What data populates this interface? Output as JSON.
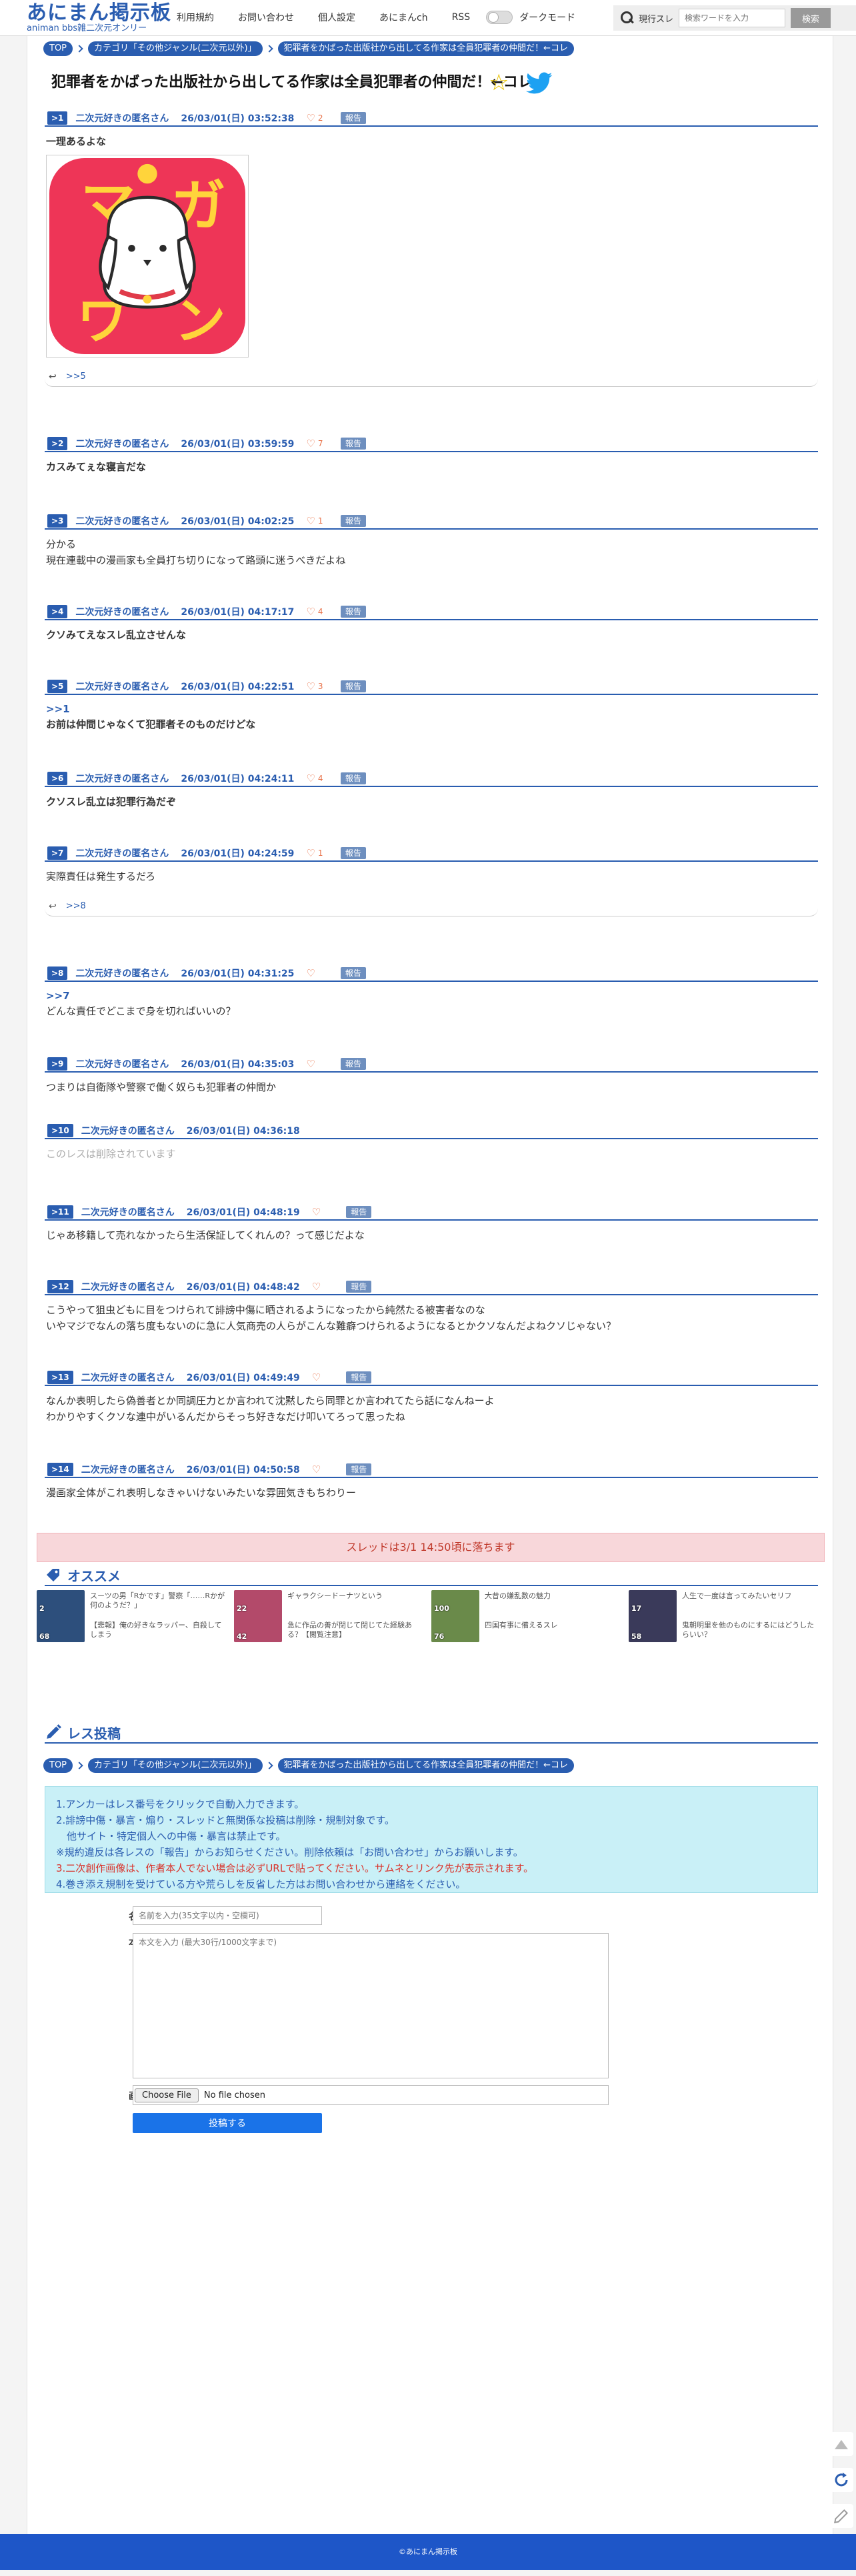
{
  "header": {
    "logo_main": "あにまん掲示板",
    "logo_sub": "animan bbs雑二次元オンリー",
    "nav": [
      "利用規約",
      "お問い合わせ",
      "個人設定",
      "あにまんch",
      "RSS"
    ],
    "dark_mode_label": "ダークモード",
    "search_scope": "現行スレ",
    "search_placeholder": "検索ワードを入力",
    "search_button": "検索"
  },
  "breadcrumb": [
    "TOP",
    "カテゴリ「その他ジャンル(二次元以外)」",
    "犯罪者をかばった出版社から出してる作家は全員犯罪者の仲間だ！←コレ"
  ],
  "thread_title": "犯罪者をかばった出版社から出してる作家は全員犯罪者の仲間だ！←コレ",
  "report_label": "報告",
  "posts": [
    {
      "num": ">1",
      "name": "二次元好きの匿名さん",
      "date": "26/03/01(日) 03:52:38",
      "likes": "2",
      "lines": [
        "一理あるよな"
      ],
      "bold": true,
      "reply": ">>5"
    },
    {
      "num": ">2",
      "name": "二次元好きの匿名さん",
      "date": "26/03/01(日) 03:59:59",
      "likes": "7",
      "lines": [
        "カスみてぇな寝言だな"
      ],
      "bold": true
    },
    {
      "num": ">3",
      "name": "二次元好きの匿名さん",
      "date": "26/03/01(日) 04:02:25",
      "likes": "1",
      "lines": [
        "分かる",
        "現在連載中の漫画家も全員打ち切りになって路頭に迷うべきだよね"
      ],
      "bold": false
    },
    {
      "num": ">4",
      "name": "二次元好きの匿名さん",
      "date": "26/03/01(日) 04:17:17",
      "likes": "4",
      "lines": [
        "クソみてえなスレ乱立させんな"
      ],
      "bold": true
    },
    {
      "num": ">5",
      "name": "二次元好きの匿名さん",
      "date": "26/03/01(日) 04:22:51",
      "likes": "3",
      "anchor": ">>1",
      "lines": [
        "お前は仲間じゃなくて犯罪者そのものだけどな"
      ],
      "bold": true
    },
    {
      "num": ">6",
      "name": "二次元好きの匿名さん",
      "date": "26/03/01(日) 04:24:11",
      "likes": "4",
      "lines": [
        "クソスレ乱立は犯罪行為だぞ"
      ],
      "bold": true
    },
    {
      "num": ">7",
      "name": "二次元好きの匿名さん",
      "date": "26/03/01(日) 04:24:59",
      "likes": "1",
      "lines": [
        "実際責任は発生するだろ"
      ],
      "bold": false,
      "reply": ">>8"
    },
    {
      "num": ">8",
      "name": "二次元好きの匿名さん",
      "date": "26/03/01(日) 04:31:25",
      "likes": "",
      "anchor": ">>7",
      "lines": [
        "どんな責任でどこまで身を切ればいいの？"
      ],
      "bold": false
    },
    {
      "num": ">9",
      "name": "二次元好きの匿名さん",
      "date": "26/03/01(日) 04:35:03",
      "likes": "",
      "lines": [
        "つまりは自衛隊や警察で働く奴らも犯罪者の仲間か"
      ],
      "bold": false
    },
    {
      "num": ">10",
      "name": "二次元好きの匿名さん",
      "date": "26/03/01(日) 04:36:18",
      "deleted": true,
      "lines": [
        "このレスは削除されています"
      ]
    },
    {
      "num": ">11",
      "name": "二次元好きの匿名さん",
      "date": "26/03/01(日) 04:48:19",
      "likes": "",
      "lines": [
        "じゃあ移籍して売れなかったら生活保証してくれんの？って感じだよな"
      ],
      "bold": false
    },
    {
      "num": ">12",
      "name": "二次元好きの匿名さん",
      "date": "26/03/01(日) 04:48:42",
      "likes": "",
      "lines": [
        "こうやって狙虫どもに目をつけられて誹謗中傷に晒されるようになったから純然たる被害者なのな",
        "いやマジでなんの落ち度もないのに急に人気商売の人らがこんな難癖つけられるようになるとかクソなんだよねクソじゃない？"
      ],
      "bold": false
    },
    {
      "num": ">13",
      "name": "二次元好きの匿名さん",
      "date": "26/03/01(日) 04:49:49",
      "likes": "",
      "lines": [
        "なんか表明したら偽善者とか同調圧力とか言われて沈黙したら同罪とか言われてたら話になんねーよ",
        "わかりやすくクソな連中がいるんだからそっち好きなだけ叩いてろって思ったね"
      ],
      "bold": false
    },
    {
      "num": ">14",
      "name": "二次元好きの匿名さん",
      "date": "26/03/01(日) 04:50:58",
      "likes": "",
      "lines": [
        "漫画家全体がこれ表明しなきゃいけないみたいな雰囲気きもちわりー"
      ],
      "bold": false
    }
  ],
  "expire_notice": "スレッドは3/1 14:50頃に落ちます",
  "recommend_title": "オススメ",
  "recommend": [
    {
      "count_top": "2",
      "count_bottom": "68",
      "text_top": "スーツの男「Rかです」警察「……Rかが何のようだ？」",
      "text_bottom": "【悲報】俺の好きなラッパー、自殺してしまう",
      "color": "#2d4f7c"
    },
    {
      "count_top": "22",
      "count_bottom": "42",
      "text_top": "ギャラクシードーナツという",
      "text_bottom": "急に作品の善が閉じて閉じてた経験ある？【閲覧注意】",
      "color": "#b34a6a"
    },
    {
      "count_top": "100",
      "count_bottom": "76",
      "text_top": "大昔の嫌乱数の魅力",
      "text_bottom": "四国有事に備えるスレ",
      "color": "#6a8a4a"
    },
    {
      "count_top": "17",
      "count_bottom": "58",
      "text_top": "人生で一度は言ってみたいセリフ",
      "text_bottom": "鬼朝明里を他のものにするにはどうしたらいい？",
      "color": "#3a3a5a"
    }
  ],
  "post_section_title": "レス投稿",
  "rules": [
    "1.アンカーはレス番号をクリックで自動入力できます。",
    "2.誹謗中傷・暴言・煽り・スレッドと無関係な投稿は削除・規制対象です。",
    "他サイト・特定個人への中傷・暴言は禁止です。",
    "※規約違反は各レスの「報告」からお知らせください。削除依頼は「お問い合わせ」からお願いします。",
    "3.二次創作画像は、作者本人でない場合は必ずURLで貼ってください。サムネとリンク先が表示されます。",
    "4.巻き添え規制を受けている方や荒らしを反省した方はお問い合わせから連絡をください。"
  ],
  "form": {
    "name_label": "名前",
    "name_placeholder": "名前を入力(35文字以内・空欄可)",
    "body_label": "本文",
    "body_placeholder": "本文を入力 (最大30行/1000文字まで)",
    "image_label": "画像",
    "file_button": "Choose File",
    "file_status": "No file chosen",
    "submit": "投稿する"
  },
  "footer": "©あにまん掲示板",
  "colors": {
    "accent": "#2a5db0",
    "report": "#6e8fbf",
    "heart": "#e8734a",
    "expire_bg": "#f8d7da",
    "rules_bg": "#c9f0f7",
    "footer": "#1e56c8"
  }
}
